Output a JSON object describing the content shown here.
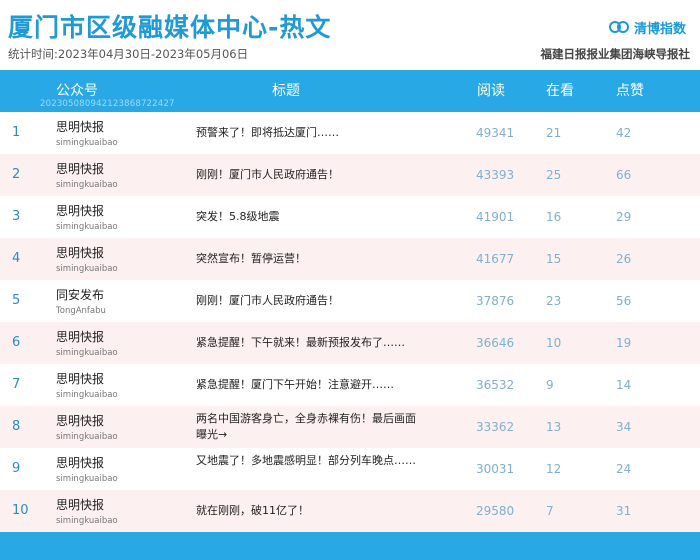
{
  "header": {
    "title": "厦门市区级融媒体中心-热文",
    "period": "统计时间:2023年04月30日-2023年05月06日",
    "brand": "清博指数",
    "publisher": "福建日报报业集团海峡导报社"
  },
  "table": {
    "columns": {
      "account": "公众号",
      "title": "标题",
      "reads": "阅读",
      "now_reading": "在看",
      "likes": "点赞"
    },
    "stamp": "202305080942123868722427",
    "rows": [
      {
        "rank": "1",
        "account": "思明快报",
        "account_id": "simingkuaibao",
        "title": "预警来了！即将抵达厦门……",
        "reads": "49341",
        "now_reading": "21",
        "likes": "42"
      },
      {
        "rank": "2",
        "account": "思明快报",
        "account_id": "simingkuaibao",
        "title": "刚刚！厦门市人民政府通告！",
        "reads": "43393",
        "now_reading": "25",
        "likes": "66"
      },
      {
        "rank": "3",
        "account": "思明快报",
        "account_id": "simingkuaibao",
        "title": "突发！5.8级地震",
        "reads": "41901",
        "now_reading": "16",
        "likes": "29"
      },
      {
        "rank": "4",
        "account": "思明快报",
        "account_id": "simingkuaibao",
        "title": "突然宣布！暂停运营！",
        "reads": "41677",
        "now_reading": "15",
        "likes": "26"
      },
      {
        "rank": "5",
        "account": "同安发布",
        "account_id": "TongAnfabu",
        "title": "刚刚！厦门市人民政府通告！",
        "reads": "37876",
        "now_reading": "23",
        "likes": "56"
      },
      {
        "rank": "6",
        "account": "思明快报",
        "account_id": "simingkuaibao",
        "title": "紧急提醒！下午就来！最新预报发布了……",
        "reads": "36646",
        "now_reading": "10",
        "likes": "19"
      },
      {
        "rank": "7",
        "account": "思明快报",
        "account_id": "simingkuaibao",
        "title": "紧急提醒！厦门下午开始！注意避开……",
        "reads": "36532",
        "now_reading": "9",
        "likes": "14"
      },
      {
        "rank": "8",
        "account": "思明快报",
        "account_id": "simingkuaibao",
        "title": "两名中国游客身亡，全身赤裸有伤！最后画面曝光→",
        "reads": "33362",
        "now_reading": "13",
        "likes": "34"
      },
      {
        "rank": "9",
        "account": "思明快报",
        "account_id": "simingkuaibao",
        "title": "又地震了！多地震感明显！部分列车晚点……",
        "reads": "30031",
        "now_reading": "12",
        "likes": "24"
      },
      {
        "rank": "10",
        "account": "思明快报",
        "account_id": "simingkuaibao",
        "title": "就在刚刚，破11亿了！",
        "reads": "29580",
        "now_reading": "7",
        "likes": "31"
      }
    ]
  },
  "colors": {
    "accent": "#29a8e6",
    "title": "#1f9ad6",
    "row_tint": "#fcf0f0",
    "number": "#7fb0cf"
  },
  "icons": {
    "brand": "double-circle-logo-icon"
  }
}
